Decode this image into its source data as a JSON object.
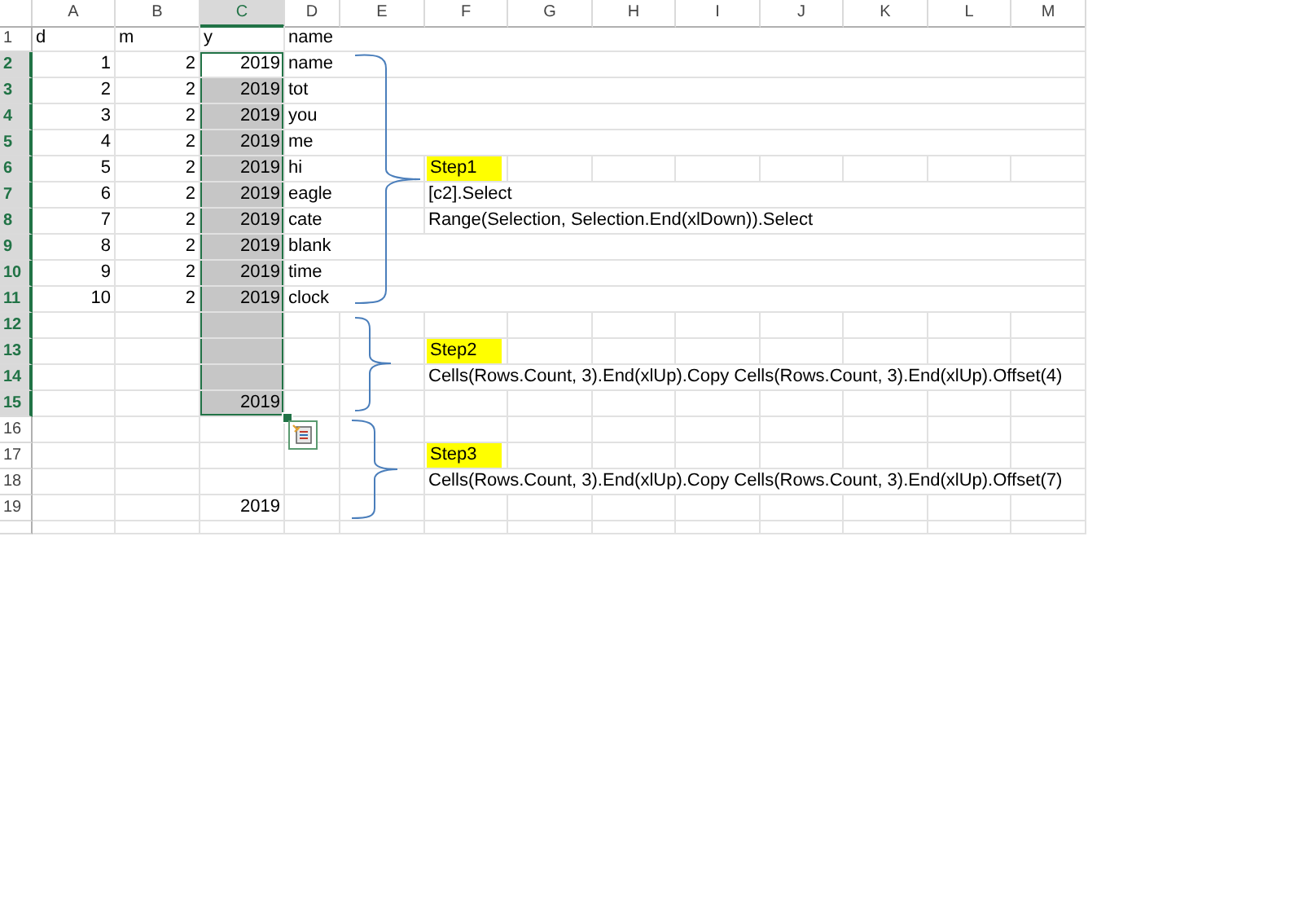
{
  "columns": [
    {
      "label": "A",
      "selected": false
    },
    {
      "label": "B",
      "selected": false
    },
    {
      "label": "C",
      "selected": true
    },
    {
      "label": "D",
      "selected": false
    },
    {
      "label": "E",
      "selected": false
    },
    {
      "label": "F",
      "selected": false
    },
    {
      "label": "G",
      "selected": false
    },
    {
      "label": "H",
      "selected": false
    },
    {
      "label": "I",
      "selected": false
    },
    {
      "label": "J",
      "selected": false
    },
    {
      "label": "K",
      "selected": false
    },
    {
      "label": "L",
      "selected": false
    },
    {
      "label": "M",
      "selected": false
    }
  ],
  "rows": [
    {
      "number": "1",
      "selected": false,
      "cells": [
        {
          "kind": "text",
          "text": "d"
        },
        {
          "kind": "text",
          "text": "m"
        },
        {
          "kind": "text",
          "text": "y"
        },
        {
          "kind": "text",
          "text": "name"
        }
      ]
    },
    {
      "number": "2",
      "selected": true,
      "cells": [
        {
          "kind": "number",
          "text": "1"
        },
        {
          "kind": "number",
          "text": "2"
        },
        {
          "kind": "number",
          "text": "2019"
        },
        {
          "kind": "text",
          "text": "name"
        }
      ]
    },
    {
      "number": "3",
      "selected": true,
      "cells": [
        {
          "kind": "number",
          "text": "2"
        },
        {
          "kind": "number",
          "text": "2"
        },
        {
          "kind": "number",
          "text": "2019"
        },
        {
          "kind": "text",
          "text": "tot"
        }
      ]
    },
    {
      "number": "4",
      "selected": true,
      "cells": [
        {
          "kind": "number",
          "text": "3"
        },
        {
          "kind": "number",
          "text": "2"
        },
        {
          "kind": "number",
          "text": "2019"
        },
        {
          "kind": "text",
          "text": "you"
        }
      ]
    },
    {
      "number": "5",
      "selected": true,
      "cells": [
        {
          "kind": "number",
          "text": "4"
        },
        {
          "kind": "number",
          "text": "2"
        },
        {
          "kind": "number",
          "text": "2019"
        },
        {
          "kind": "text",
          "text": "me"
        }
      ]
    },
    {
      "number": "6",
      "selected": true,
      "cells": [
        {
          "kind": "number",
          "text": "5"
        },
        {
          "kind": "number",
          "text": "2"
        },
        {
          "kind": "number",
          "text": "2019"
        },
        {
          "kind": "text",
          "text": "hi"
        },
        {
          "kind": "empty"
        },
        {
          "kind": "step",
          "text": "Step1"
        }
      ]
    },
    {
      "number": "7",
      "selected": true,
      "cells": [
        {
          "kind": "number",
          "text": "6"
        },
        {
          "kind": "number",
          "text": "2"
        },
        {
          "kind": "number",
          "text": "2019"
        },
        {
          "kind": "text",
          "text": "eagle"
        },
        {
          "kind": "empty"
        },
        {
          "kind": "text",
          "text": "[c2].Select"
        }
      ]
    },
    {
      "number": "8",
      "selected": true,
      "cells": [
        {
          "kind": "number",
          "text": "7"
        },
        {
          "kind": "number",
          "text": "2"
        },
        {
          "kind": "number",
          "text": "2019"
        },
        {
          "kind": "text",
          "text": "cate"
        },
        {
          "kind": "empty"
        },
        {
          "kind": "text",
          "text": "Range(Selection, Selection.End(xlDown)).Select"
        }
      ]
    },
    {
      "number": "9",
      "selected": true,
      "cells": [
        {
          "kind": "number",
          "text": "8"
        },
        {
          "kind": "number",
          "text": "2"
        },
        {
          "kind": "number",
          "text": "2019"
        },
        {
          "kind": "text",
          "text": "blank"
        }
      ]
    },
    {
      "number": "10",
      "selected": true,
      "cells": [
        {
          "kind": "number",
          "text": "9"
        },
        {
          "kind": "number",
          "text": "2"
        },
        {
          "kind": "number",
          "text": "2019"
        },
        {
          "kind": "text",
          "text": "time"
        }
      ]
    },
    {
      "number": "11",
      "selected": true,
      "cells": [
        {
          "kind": "number",
          "text": "10"
        },
        {
          "kind": "number",
          "text": "2"
        },
        {
          "kind": "number",
          "text": "2019"
        },
        {
          "kind": "text",
          "text": "clock"
        }
      ]
    },
    {
      "number": "12",
      "selected": true
    },
    {
      "number": "13",
      "selected": true,
      "cells": [
        {
          "kind": "empty"
        },
        {
          "kind": "empty"
        },
        {
          "kind": "empty"
        },
        {
          "kind": "empty"
        },
        {
          "kind": "empty"
        },
        {
          "kind": "step",
          "text": "Step2"
        }
      ]
    },
    {
      "number": "14",
      "selected": true,
      "cells": [
        {
          "kind": "empty"
        },
        {
          "kind": "empty"
        },
        {
          "kind": "empty"
        },
        {
          "kind": "empty"
        },
        {
          "kind": "empty"
        },
        {
          "kind": "text",
          "text": "Cells(Rows.Count, 3).End(xlUp).Copy Cells(Rows.Count, 3).End(xlUp).Offset(4)"
        }
      ]
    },
    {
      "number": "15",
      "selected": true,
      "cells": [
        {
          "kind": "empty"
        },
        {
          "kind": "empty"
        },
        {
          "kind": "number",
          "text": "2019"
        }
      ]
    },
    {
      "number": "16",
      "selected": false
    },
    {
      "number": "17",
      "selected": false,
      "cells": [
        {
          "kind": "empty"
        },
        {
          "kind": "empty"
        },
        {
          "kind": "empty"
        },
        {
          "kind": "empty"
        },
        {
          "kind": "empty"
        },
        {
          "kind": "step",
          "text": "Step3"
        }
      ]
    },
    {
      "number": "18",
      "selected": false,
      "cells": [
        {
          "kind": "empty"
        },
        {
          "kind": "empty"
        },
        {
          "kind": "empty"
        },
        {
          "kind": "empty"
        },
        {
          "kind": "empty"
        },
        {
          "kind": "text",
          "text": "Cells(Rows.Count, 3).End(xlUp).Copy Cells(Rows.Count, 3).End(xlUp).Offset(7)"
        }
      ]
    },
    {
      "number": "19",
      "selected": false,
      "cells": [
        {
          "kind": "empty"
        },
        {
          "kind": "empty"
        },
        {
          "kind": "number",
          "text": "2019"
        }
      ]
    }
  ]
}
